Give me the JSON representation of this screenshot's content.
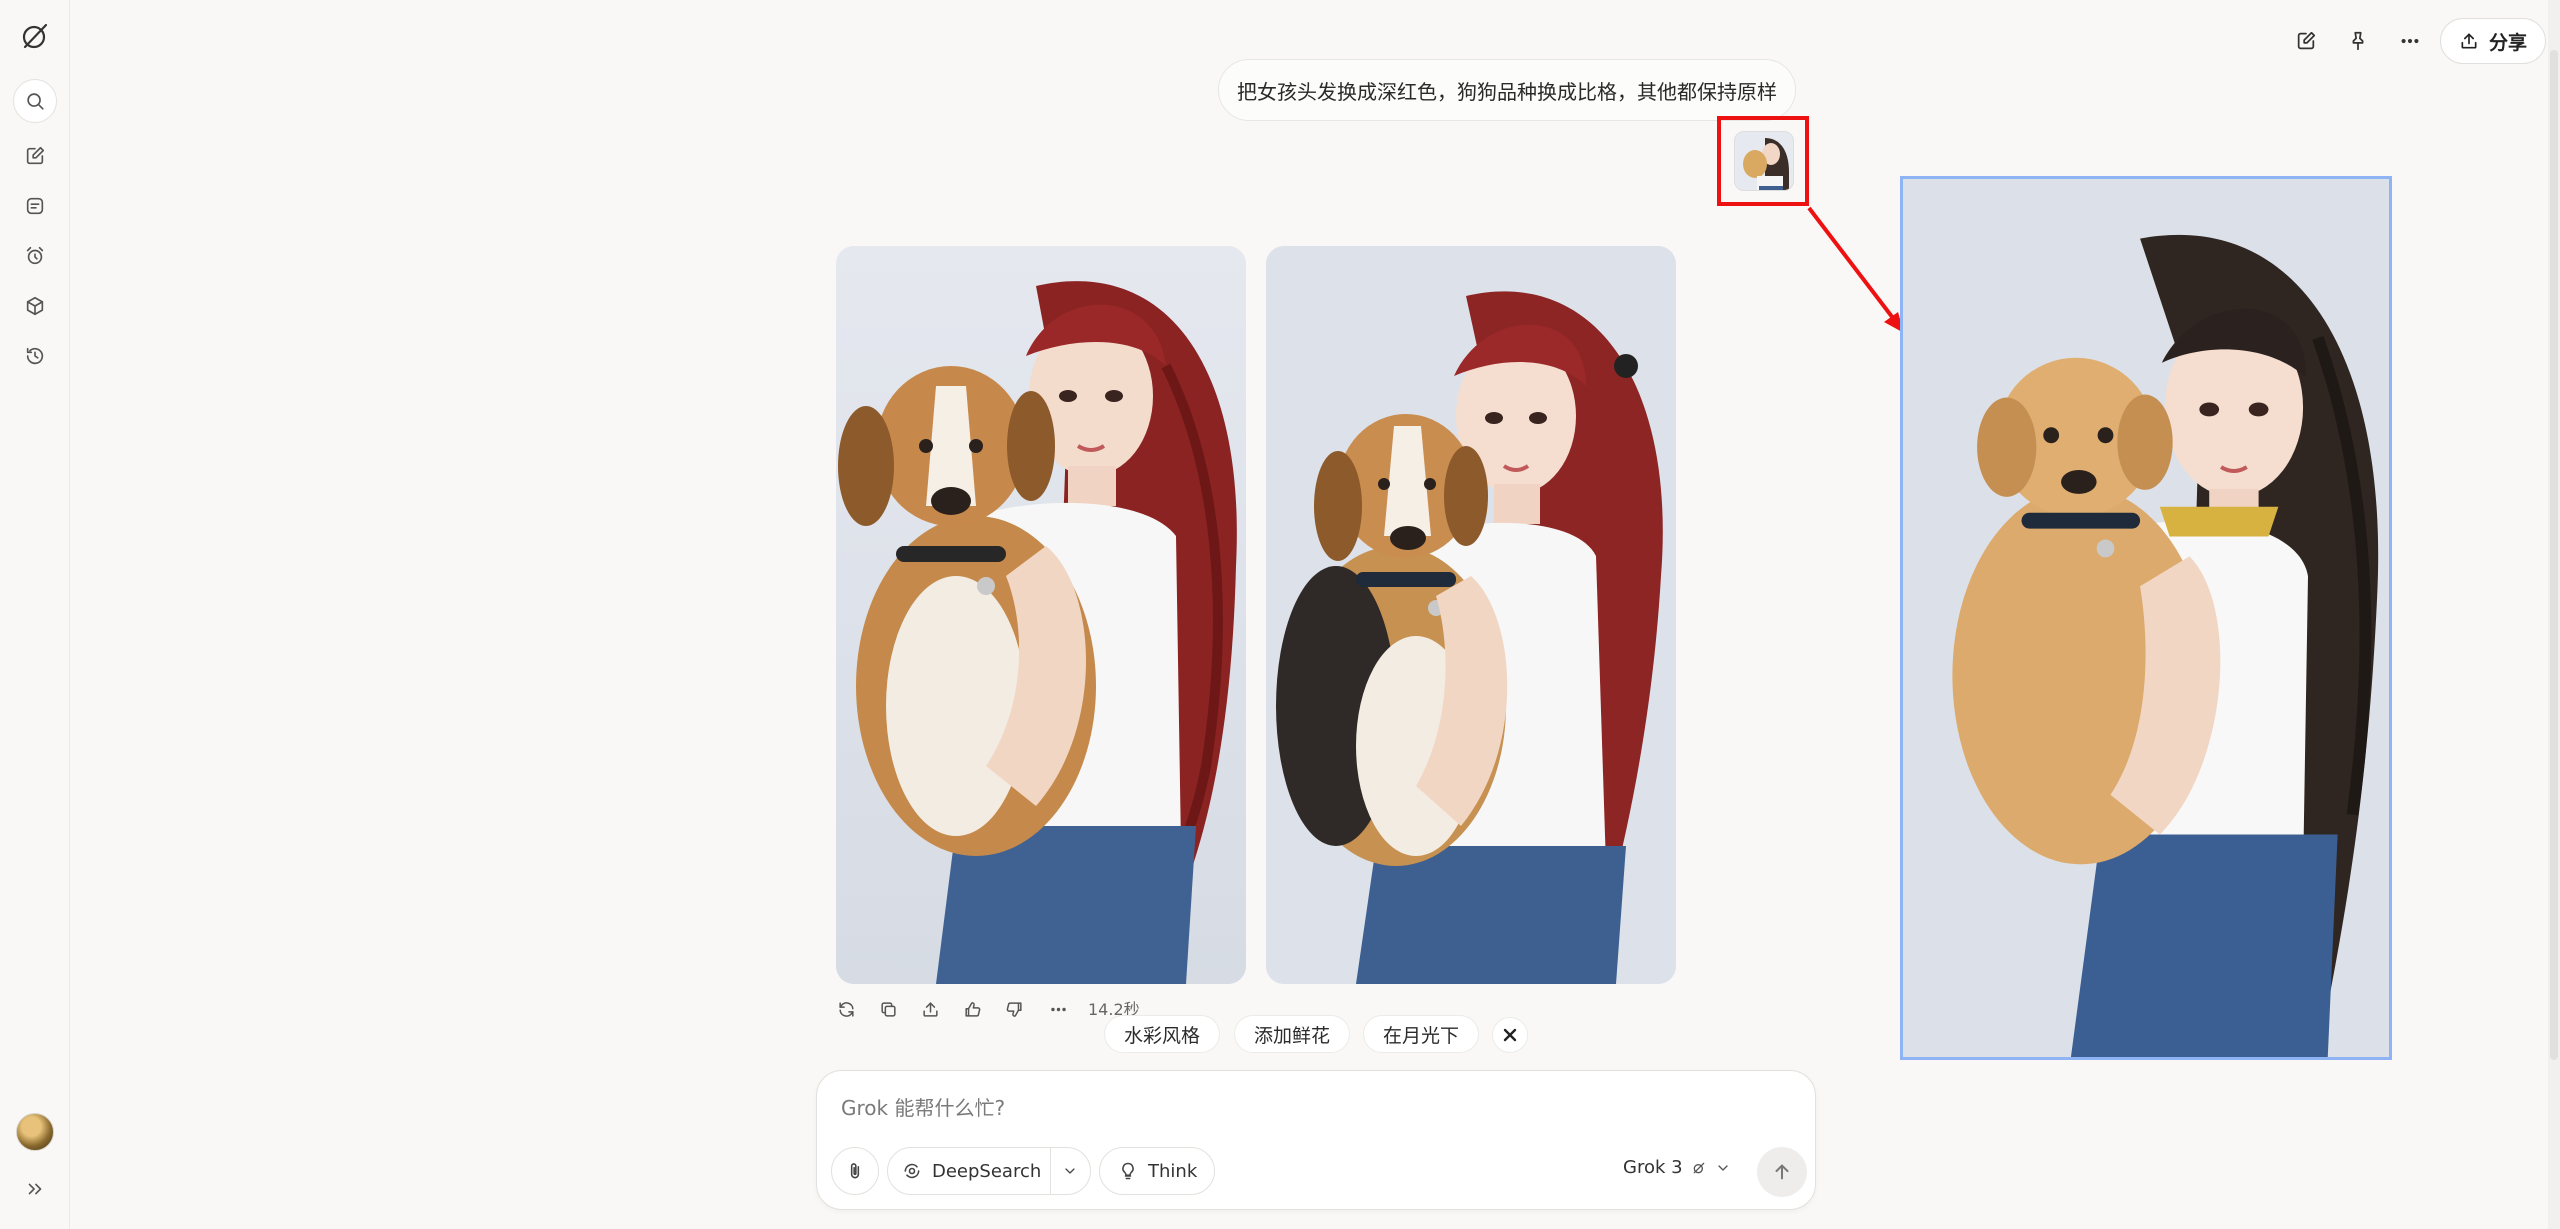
{
  "app": {
    "accent": "#8fb4f6",
    "highlight": "#ee1111"
  },
  "sidebar": {
    "items": [
      {
        "icon": "grok-logo-icon"
      },
      {
        "icon": "search-icon"
      },
      {
        "icon": "edit-icon"
      },
      {
        "icon": "notes-icon"
      },
      {
        "icon": "alarm-icon"
      },
      {
        "icon": "cube-icon"
      },
      {
        "icon": "history-icon"
      }
    ],
    "expand_icon": "double-chevron-right-icon"
  },
  "topbar": {
    "share_label": "分享",
    "icons": [
      "edit-icon",
      "pin-icon",
      "more-icon",
      "upload-icon"
    ]
  },
  "message": {
    "user_text": "把女孩头发换成深红色，狗狗品种换成比格，其他都保持原样"
  },
  "response": {
    "elapsed": "14.2秒",
    "actions": [
      "regenerate-icon",
      "copy-icon",
      "share-icon",
      "thumbs-up-icon",
      "thumbs-down-icon",
      "more-icon"
    ]
  },
  "suggestions": [
    "水彩风格",
    "添加鲜花",
    "在月光下"
  ],
  "composer": {
    "placeholder": "Grok 能帮什么忙?",
    "deepsearch_label": "DeepSearch",
    "think_label": "Think",
    "model_label": "Grok 3"
  }
}
